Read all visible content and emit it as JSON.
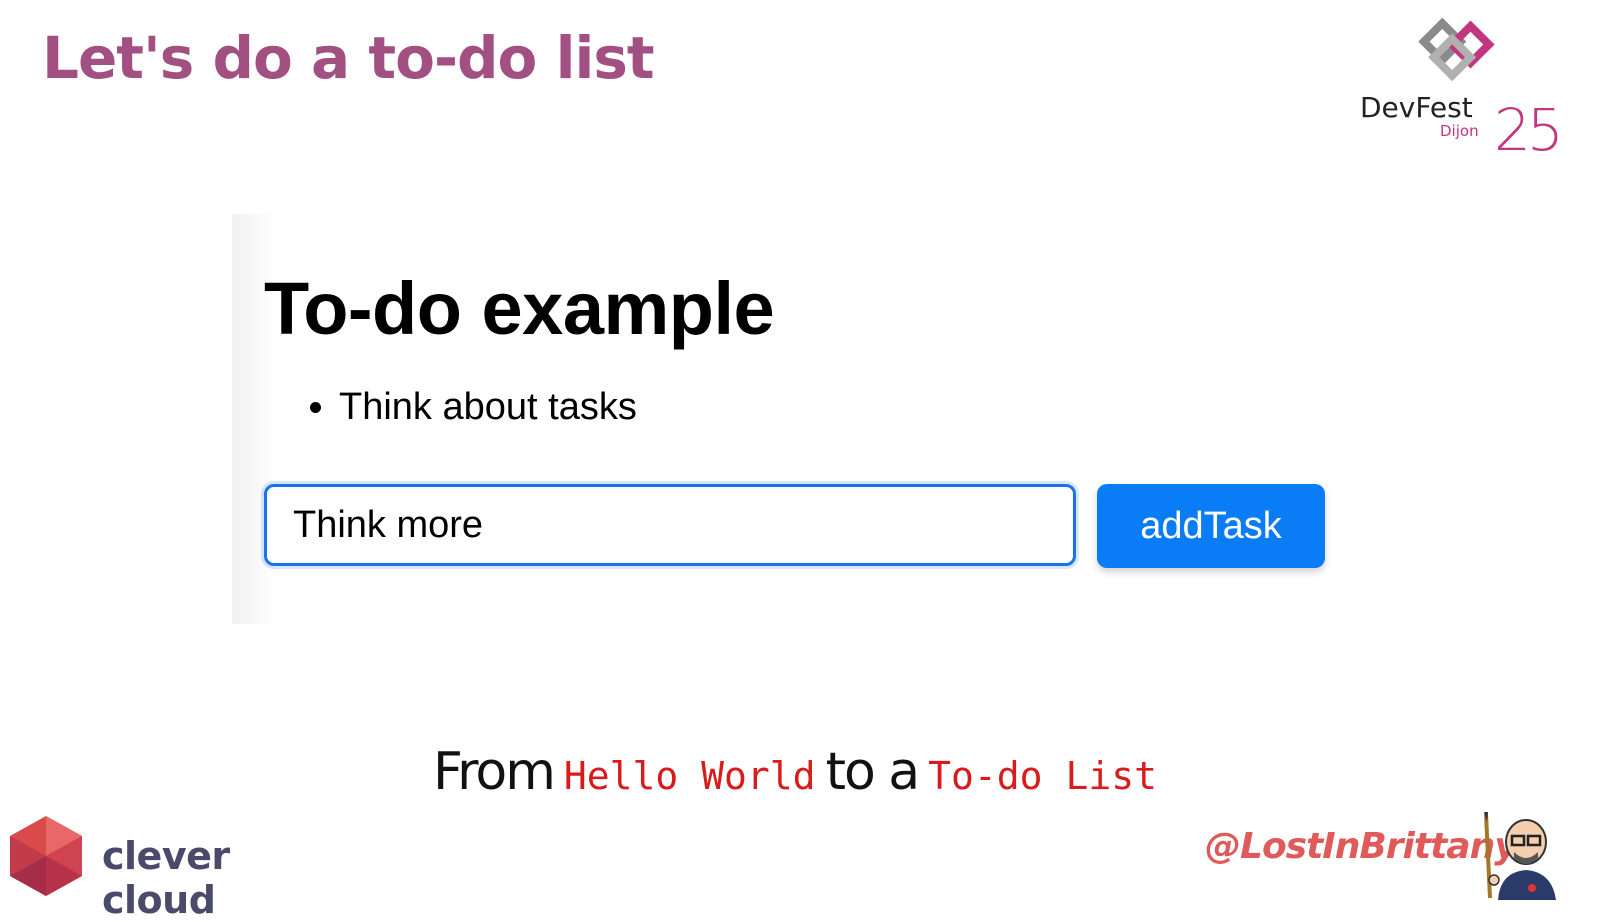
{
  "slide": {
    "title": "Let's do a to-do list",
    "accent_color": "#a24f82"
  },
  "devfest_logo": {
    "name": "DevFest",
    "city": "Dijon",
    "year": "25",
    "icon": "devfest-diamond-logo"
  },
  "demo": {
    "heading": "To-do example",
    "tasks": [
      "Think about tasks"
    ],
    "input_value": "Think more",
    "button_label": "addTask",
    "button_color": "#0a7cf5",
    "focus_color": "#1a73e8"
  },
  "tagline": {
    "from": "From",
    "code1": "Hello World",
    "to": "to a",
    "code2": "To-do List",
    "code_color": "#d81b1b"
  },
  "footer": {
    "company": "clever cloud",
    "company_icon": "clever-cloud-hexagon-logo",
    "handle": "@LostInBrittany",
    "avatar_icon": "cartoon-avatar-icon"
  }
}
